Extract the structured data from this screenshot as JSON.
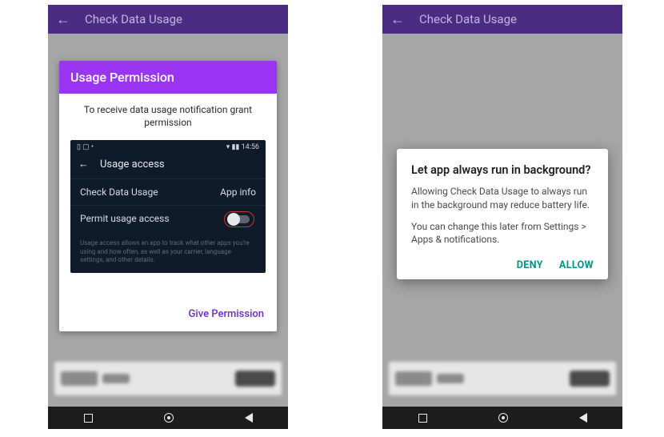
{
  "left": {
    "appbar": {
      "title": "Check Data Usage"
    },
    "card": {
      "header": "Usage Permission",
      "subtitle": "To receive data usage notification grant permission",
      "inner": {
        "status_left": "▯ ▢ •",
        "status_right": "▾ ▮▮ 14:56",
        "title": "Usage access",
        "row1_left": "Check Data Usage",
        "row1_right": "App info",
        "row2_left": "Permit usage access",
        "help": "Usage access allows an app to track what other apps you're using and how often, as well as your carrier, language settings, and other details."
      },
      "action": "Give Permission"
    }
  },
  "right": {
    "appbar": {
      "title": "Check Data Usage"
    },
    "dialog": {
      "title": "Let app always run in background?",
      "body1": "Allowing Check Data Usage to always run in the background may reduce battery life.",
      "body2": "You can change this later from Settings > Apps & notifications.",
      "deny": "DENY",
      "allow": "ALLOW"
    }
  }
}
